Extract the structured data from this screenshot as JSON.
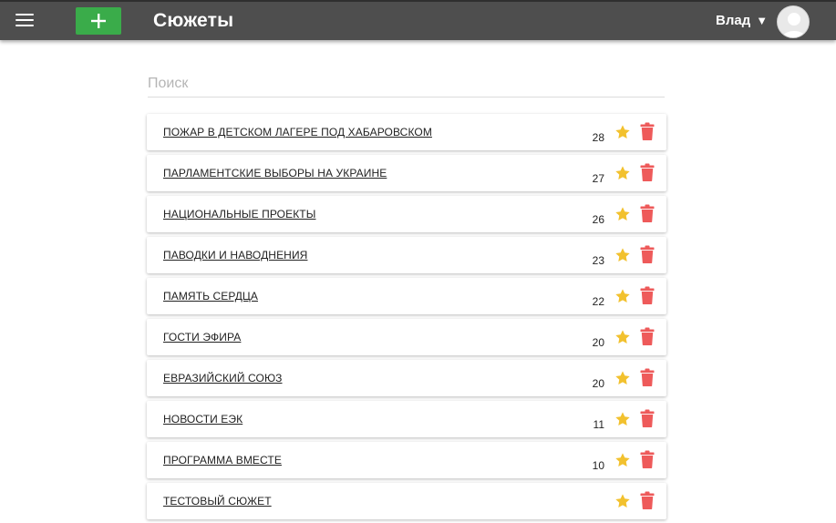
{
  "header": {
    "title": "Сюжеты",
    "user_name": "Влад",
    "user_caret": "▼",
    "colors": {
      "bar": "#4e4e4e",
      "add_button": "#3aac4a"
    }
  },
  "search": {
    "placeholder": "Поиск",
    "value": ""
  },
  "list": {
    "star_color": "#f2c12e",
    "trash_color": "#ee5a5a",
    "items": [
      {
        "title": "ПОЖАР В ДЕТСКОМ ЛАГЕРЕ ПОД ХАБАРОВСКОМ",
        "count": "28"
      },
      {
        "title": "ПАРЛАМЕНТСКИЕ ВЫБОРЫ НА УКРАИНЕ",
        "count": "27"
      },
      {
        "title": "НАЦИОНАЛЬНЫЕ ПРОЕКТЫ",
        "count": "26"
      },
      {
        "title": "ПАВОДКИ И НАВОДНЕНИЯ",
        "count": "23"
      },
      {
        "title": "ПАМЯТЬ СЕРДЦА",
        "count": "22"
      },
      {
        "title": "ГОСТИ ЭФИРА",
        "count": "20"
      },
      {
        "title": "ЕВРАЗИЙСКИЙ СОЮЗ",
        "count": "20"
      },
      {
        "title": "НОВОСТИ ЕЭК",
        "count": "11"
      },
      {
        "title": "ПРОГРАММА ВМЕСТЕ",
        "count": "10"
      },
      {
        "title": "ТЕСТОВЫЙ СЮЖЕТ",
        "count": ""
      }
    ]
  }
}
